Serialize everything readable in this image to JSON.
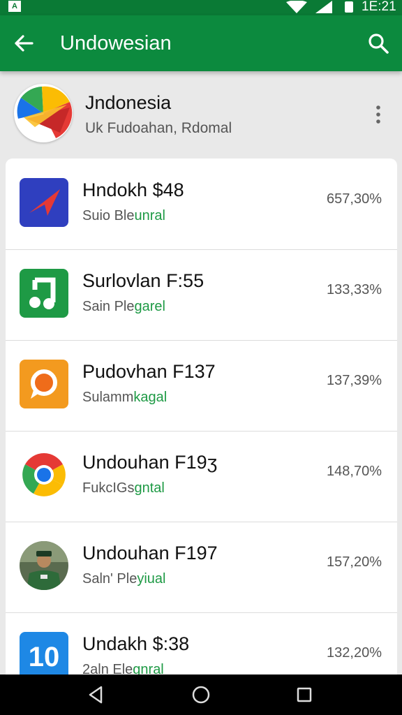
{
  "status_bar": {
    "time": "1E:21",
    "carrier_glyph": "A",
    "icons": [
      "wifi-icon",
      "signal-icon",
      "battery-icon"
    ]
  },
  "app_bar": {
    "title": "Undowesian",
    "icons": [
      "back-arrow-icon",
      "search-icon"
    ],
    "color": "#0c8a3e"
  },
  "header": {
    "name": "Jndonesia",
    "subtitle": "Uk Fudoahan, Rdomal",
    "icons": [
      "app-logo-icon",
      "more-vert-icon"
    ]
  },
  "accent_color": "#1e9a45",
  "items": [
    {
      "title": "Hndokh $48",
      "sub_prefix": "Suio Ble",
      "sub_accent": "unral",
      "value": "657,30%",
      "icon": "send-arrow-icon"
    },
    {
      "title": "Surlovlan F:55",
      "sub_prefix": "Sain Ple",
      "sub_accent": "garel",
      "value": "133,33%",
      "icon": "music-note-icon"
    },
    {
      "title": "Pudovhan F137",
      "sub_prefix": "Sulamm",
      "sub_accent": "kagal",
      "value": "137,39%",
      "icon": "chat-bubble-icon"
    },
    {
      "title": "Undouhan F19ʒ",
      "sub_prefix": "FukcIGs",
      "sub_accent": "gntal",
      "value": "148,70%",
      "icon": "chrome-icon"
    },
    {
      "title": "Undouhan F197",
      "sub_prefix": "Saln' Ple",
      "sub_accent": "yiual",
      "value": "157,20%",
      "icon": "person-photo-icon"
    },
    {
      "title": "Undakh $:38",
      "sub_prefix": "2aln Ele",
      "sub_accent": "gnral",
      "value": "132,20%",
      "icon": "number-10-icon",
      "icon_text": "10"
    }
  ],
  "nav_bar": {
    "icons": [
      "nav-back-icon",
      "nav-home-icon",
      "nav-recents-icon"
    ]
  }
}
